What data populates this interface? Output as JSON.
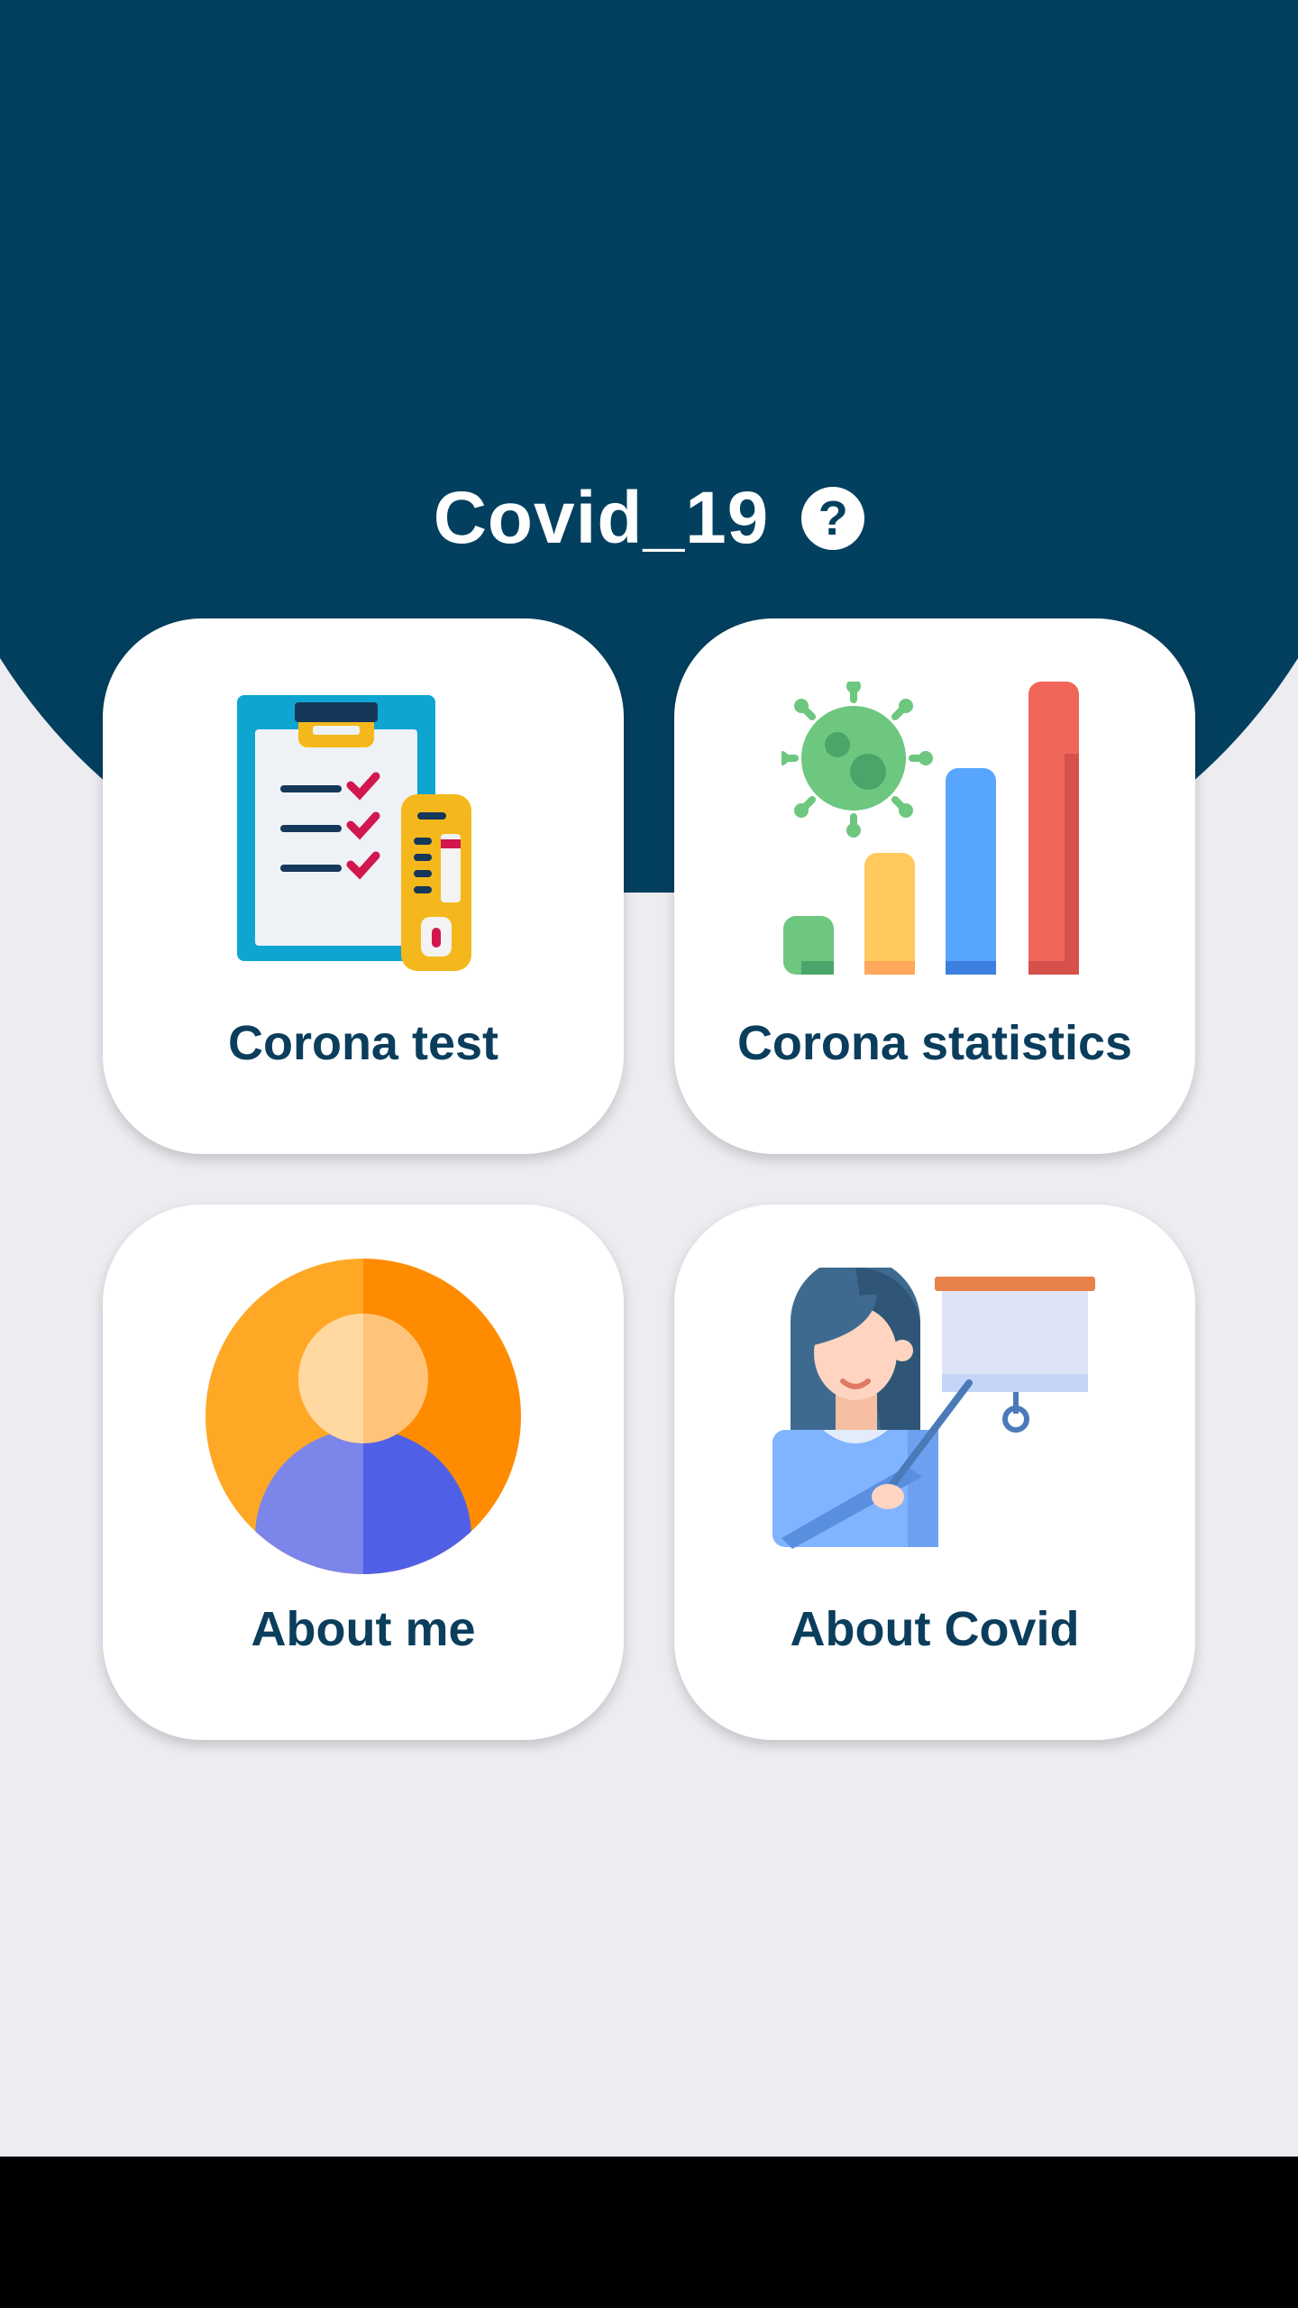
{
  "app": {
    "title": "Covid_19",
    "help_icon": "?"
  },
  "colors": {
    "header": "#03405f",
    "background": "#edecf1",
    "card": "#ffffff",
    "label": "#0b3d5c"
  },
  "menu": [
    {
      "label": "Corona test",
      "icon": "clipboard-test-icon"
    },
    {
      "label": "Corona statistics",
      "icon": "virus-chart-icon"
    },
    {
      "label": "About me",
      "icon": "user-avatar-icon"
    },
    {
      "label": "About Covid",
      "icon": "teacher-presentation-icon"
    }
  ]
}
